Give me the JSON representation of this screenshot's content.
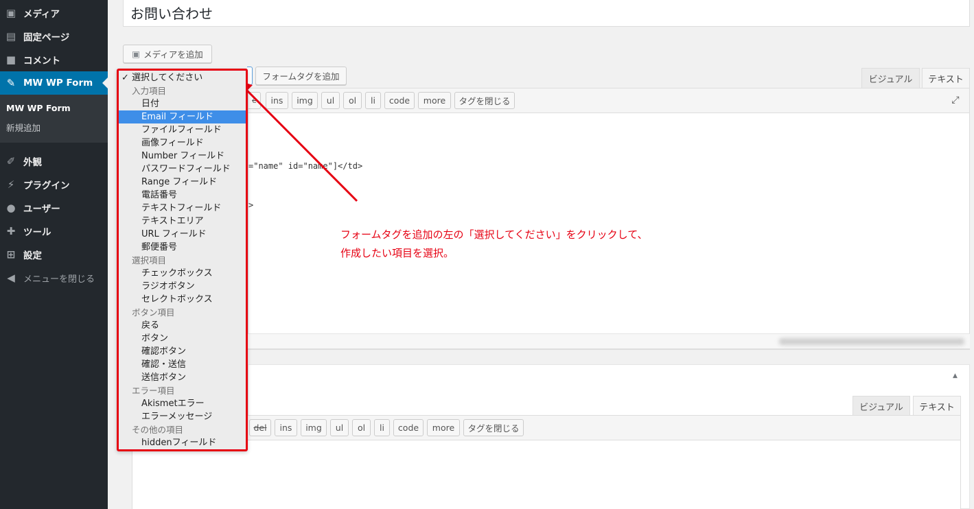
{
  "sidebar": {
    "items": [
      {
        "label": "メディア",
        "icon": "media-icon"
      },
      {
        "label": "固定ページ",
        "icon": "page-icon"
      },
      {
        "label": "コメント",
        "icon": "comment-icon"
      },
      {
        "label": "MW WP Form",
        "icon": "pin-icon"
      },
      {
        "label": "外観",
        "icon": "appearance-icon"
      },
      {
        "label": "プラグイン",
        "icon": "plugin-icon"
      },
      {
        "label": "ユーザー",
        "icon": "user-icon"
      },
      {
        "label": "ツール",
        "icon": "tool-icon"
      },
      {
        "label": "設定",
        "icon": "settings-icon"
      }
    ],
    "submenu": [
      "MW WP Form",
      "新規追加"
    ],
    "collapse_label": "メニューを閉じる"
  },
  "post": {
    "title": "お問い合わせ"
  },
  "toolbar": {
    "media_button": "メディアを追加",
    "form_tag_button": "フォームタグを追加"
  },
  "editor_tabs": [
    "ビジュアル",
    "テキスト"
  ],
  "quicktags": [
    "del",
    "ins",
    "img",
    "ul",
    "ol",
    "li",
    "code",
    "more",
    "タグを閉じる"
  ],
  "code_lines": [
    "=\"name\" id=\"name\"]</td>",
    ">"
  ],
  "dropdown": {
    "selected": "選択してください",
    "groups": [
      {
        "label": "入力項目",
        "options": [
          "日付",
          "Email フィールド",
          "ファイルフィールド",
          "画像フィールド",
          "Number フィールド",
          "パスワードフィールド",
          "Range フィールド",
          "電話番号",
          "テキストフィールド",
          "テキストエリア",
          "URL フィールド",
          "郵便番号"
        ]
      },
      {
        "label": "選択項目",
        "options": [
          "チェックボックス",
          "ラジオボタン",
          "セレクトボックス"
        ]
      },
      {
        "label": "ボタン項目",
        "options": [
          "戻る",
          "ボタン",
          "確認ボタン",
          "確認・送信",
          "送信ボタン"
        ]
      },
      {
        "label": "エラー項目",
        "options": [
          "Akismetエラー",
          "エラーメッセージ"
        ]
      },
      {
        "label": "その他の項目",
        "options": [
          "hiddenフィールド"
        ]
      }
    ],
    "highlighted": "Email フィールド"
  },
  "annotation": {
    "line1": "フォームタグを追加の左の「選択してください」をクリックして、",
    "line2": "作成したい項目を選択。"
  },
  "colors": {
    "sidebar_bg": "#23282d",
    "active_menu": "#0073aa",
    "annotation_red": "#e60012",
    "highlight_blue": "#3e8ee8"
  }
}
